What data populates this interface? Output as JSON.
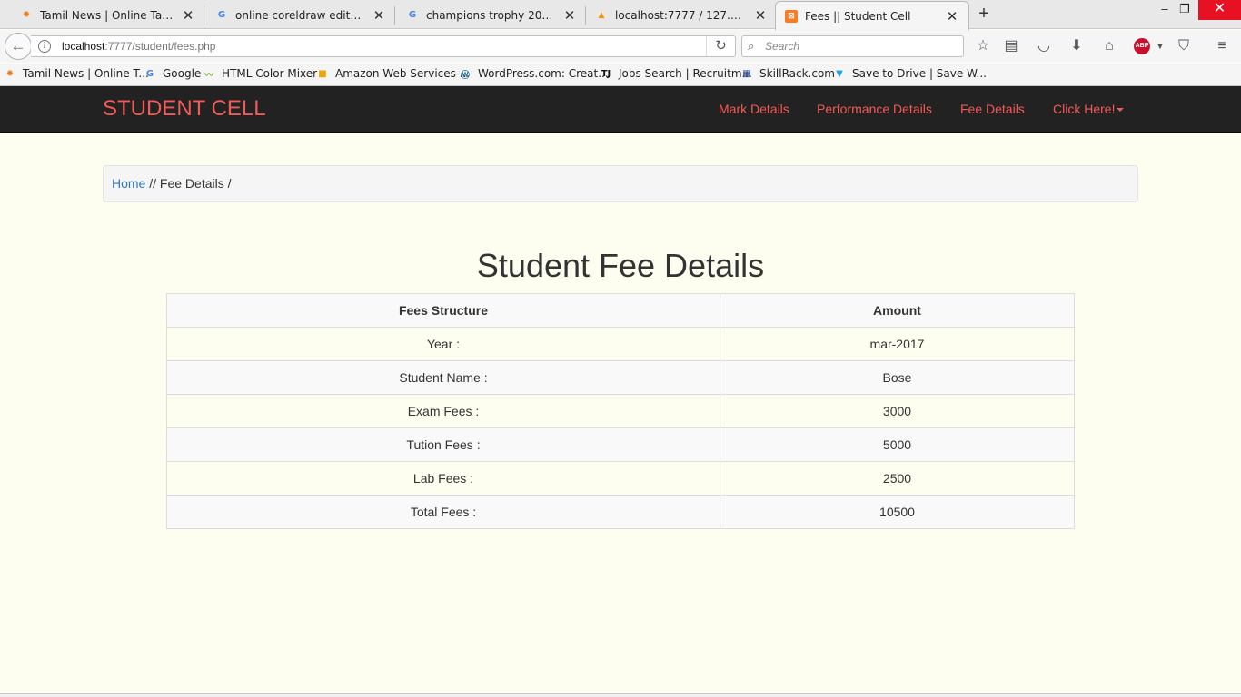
{
  "browser": {
    "tabs": [
      {
        "title": "Tamil News | Online Tamil...",
        "icon": "sun-icon",
        "active": false
      },
      {
        "title": "online coreldraw editor fre...",
        "icon": "google-icon",
        "active": false
      },
      {
        "title": "champions trophy 2017 liv...",
        "icon": "google-icon",
        "active": false
      },
      {
        "title": "localhost:7777 / 127.0.0.1 |...",
        "icon": "phpmyadmin-icon",
        "active": false
      },
      {
        "title": "Fees || Student Cell",
        "icon": "xampp-icon",
        "active": true
      }
    ],
    "url_host": "localhost",
    "url_path": ":7777/student/fees.php",
    "search_placeholder": "Search",
    "bookmarks": [
      {
        "label": "Tamil News | Online T...",
        "icon": "sun-icon"
      },
      {
        "label": "Google",
        "icon": "google-icon"
      },
      {
        "label": "HTML Color Mixer",
        "icon": "chart-icon"
      },
      {
        "label": "Amazon Web Services ...",
        "icon": "box-icon"
      },
      {
        "label": "WordPress.com: Creat...",
        "icon": "wordpress-icon"
      },
      {
        "label": "Jobs Search | Recruitm...",
        "icon": "tj-icon"
      },
      {
        "label": "SkillRack.com",
        "icon": "skillrack-icon"
      },
      {
        "label": "Save to Drive | Save W...",
        "icon": "drive-icon"
      }
    ]
  },
  "site": {
    "brand": "STUDENT CELL",
    "nav": {
      "mark_details": "Mark Details",
      "performance_details": "Performance Details",
      "fee_details": "Fee Details",
      "click_here": "Click Here!"
    },
    "breadcrumb": {
      "home": "Home",
      "rest": " // Fee Details /"
    },
    "title": "Student Fee Details",
    "table": {
      "headers": [
        "Fees Structure",
        "Amount"
      ],
      "rows": [
        [
          "Year :",
          "mar-2017"
        ],
        [
          "Student Name :",
          "Bose"
        ],
        [
          "Exam Fees :",
          "3000"
        ],
        [
          "Tution Fees :",
          "5000"
        ],
        [
          "Lab Fees :",
          "2500"
        ],
        [
          "Total Fees :",
          "10500"
        ]
      ]
    }
  },
  "colors": {
    "brand": "#f05a58",
    "navbar_bg": "#222222",
    "page_bg": "#fefef0",
    "link": "#337ab7"
  }
}
